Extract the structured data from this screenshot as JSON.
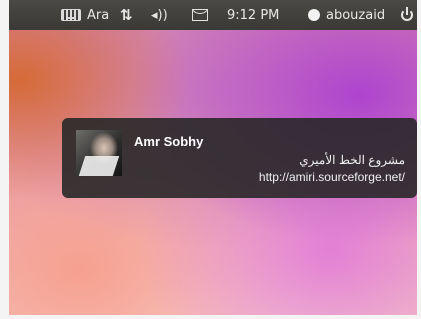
{
  "panel": {
    "keyboard": {
      "icon": "keyboard-icon",
      "label": "Ara"
    },
    "network": {
      "icon": "network-updown-icon",
      "glyph": "⇅"
    },
    "volume": {
      "icon": "volume-icon",
      "glyph": "◂))"
    },
    "messaging": {
      "icon": "mail-icon"
    },
    "clock": "9:12 PM",
    "user": {
      "icon": "user-status-icon",
      "name": "abouzaid"
    },
    "session": {
      "icon": "power-icon"
    }
  },
  "notification": {
    "avatar": "avatar-photo",
    "title": "Amr Sobhy",
    "body_line1": "مشروع الخط الأميري",
    "body_line2": "http://amiri.sourceforge.net/"
  },
  "colors": {
    "panel_bg": "#3a3935",
    "notification_bg": "#282828"
  }
}
